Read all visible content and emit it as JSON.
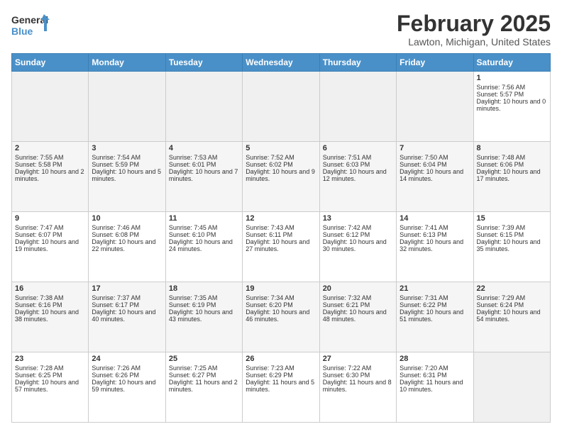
{
  "logo": {
    "line1": "General",
    "line2": "Blue"
  },
  "title": "February 2025",
  "location": "Lawton, Michigan, United States",
  "days_header": [
    "Sunday",
    "Monday",
    "Tuesday",
    "Wednesday",
    "Thursday",
    "Friday",
    "Saturday"
  ],
  "weeks": [
    [
      {
        "day": "",
        "content": ""
      },
      {
        "day": "",
        "content": ""
      },
      {
        "day": "",
        "content": ""
      },
      {
        "day": "",
        "content": ""
      },
      {
        "day": "",
        "content": ""
      },
      {
        "day": "",
        "content": ""
      },
      {
        "day": "1",
        "content": "Sunrise: 7:56 AM\nSunset: 5:57 PM\nDaylight: 10 hours and 0 minutes."
      }
    ],
    [
      {
        "day": "2",
        "content": "Sunrise: 7:55 AM\nSunset: 5:58 PM\nDaylight: 10 hours and 2 minutes."
      },
      {
        "day": "3",
        "content": "Sunrise: 7:54 AM\nSunset: 5:59 PM\nDaylight: 10 hours and 5 minutes."
      },
      {
        "day": "4",
        "content": "Sunrise: 7:53 AM\nSunset: 6:01 PM\nDaylight: 10 hours and 7 minutes."
      },
      {
        "day": "5",
        "content": "Sunrise: 7:52 AM\nSunset: 6:02 PM\nDaylight: 10 hours and 9 minutes."
      },
      {
        "day": "6",
        "content": "Sunrise: 7:51 AM\nSunset: 6:03 PM\nDaylight: 10 hours and 12 minutes."
      },
      {
        "day": "7",
        "content": "Sunrise: 7:50 AM\nSunset: 6:04 PM\nDaylight: 10 hours and 14 minutes."
      },
      {
        "day": "8",
        "content": "Sunrise: 7:48 AM\nSunset: 6:06 PM\nDaylight: 10 hours and 17 minutes."
      }
    ],
    [
      {
        "day": "9",
        "content": "Sunrise: 7:47 AM\nSunset: 6:07 PM\nDaylight: 10 hours and 19 minutes."
      },
      {
        "day": "10",
        "content": "Sunrise: 7:46 AM\nSunset: 6:08 PM\nDaylight: 10 hours and 22 minutes."
      },
      {
        "day": "11",
        "content": "Sunrise: 7:45 AM\nSunset: 6:10 PM\nDaylight: 10 hours and 24 minutes."
      },
      {
        "day": "12",
        "content": "Sunrise: 7:43 AM\nSunset: 6:11 PM\nDaylight: 10 hours and 27 minutes."
      },
      {
        "day": "13",
        "content": "Sunrise: 7:42 AM\nSunset: 6:12 PM\nDaylight: 10 hours and 30 minutes."
      },
      {
        "day": "14",
        "content": "Sunrise: 7:41 AM\nSunset: 6:13 PM\nDaylight: 10 hours and 32 minutes."
      },
      {
        "day": "15",
        "content": "Sunrise: 7:39 AM\nSunset: 6:15 PM\nDaylight: 10 hours and 35 minutes."
      }
    ],
    [
      {
        "day": "16",
        "content": "Sunrise: 7:38 AM\nSunset: 6:16 PM\nDaylight: 10 hours and 38 minutes."
      },
      {
        "day": "17",
        "content": "Sunrise: 7:37 AM\nSunset: 6:17 PM\nDaylight: 10 hours and 40 minutes."
      },
      {
        "day": "18",
        "content": "Sunrise: 7:35 AM\nSunset: 6:19 PM\nDaylight: 10 hours and 43 minutes."
      },
      {
        "day": "19",
        "content": "Sunrise: 7:34 AM\nSunset: 6:20 PM\nDaylight: 10 hours and 46 minutes."
      },
      {
        "day": "20",
        "content": "Sunrise: 7:32 AM\nSunset: 6:21 PM\nDaylight: 10 hours and 48 minutes."
      },
      {
        "day": "21",
        "content": "Sunrise: 7:31 AM\nSunset: 6:22 PM\nDaylight: 10 hours and 51 minutes."
      },
      {
        "day": "22",
        "content": "Sunrise: 7:29 AM\nSunset: 6:24 PM\nDaylight: 10 hours and 54 minutes."
      }
    ],
    [
      {
        "day": "23",
        "content": "Sunrise: 7:28 AM\nSunset: 6:25 PM\nDaylight: 10 hours and 57 minutes."
      },
      {
        "day": "24",
        "content": "Sunrise: 7:26 AM\nSunset: 6:26 PM\nDaylight: 10 hours and 59 minutes."
      },
      {
        "day": "25",
        "content": "Sunrise: 7:25 AM\nSunset: 6:27 PM\nDaylight: 11 hours and 2 minutes."
      },
      {
        "day": "26",
        "content": "Sunrise: 7:23 AM\nSunset: 6:29 PM\nDaylight: 11 hours and 5 minutes."
      },
      {
        "day": "27",
        "content": "Sunrise: 7:22 AM\nSunset: 6:30 PM\nDaylight: 11 hours and 8 minutes."
      },
      {
        "day": "28",
        "content": "Sunrise: 7:20 AM\nSunset: 6:31 PM\nDaylight: 11 hours and 10 minutes."
      },
      {
        "day": "",
        "content": ""
      }
    ]
  ]
}
